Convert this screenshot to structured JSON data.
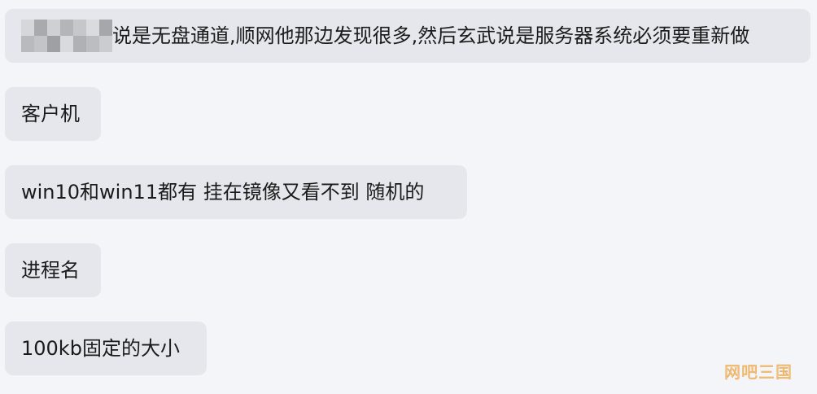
{
  "messages": [
    {
      "text": "说是无盘通道,顺网他那边发现很多,然后玄武说是服务器系统必须要重新做"
    },
    {
      "text": "客户机"
    },
    {
      "text": "win10和win11都有 挂在镜像又看不到 随机的"
    },
    {
      "text": "进程名"
    },
    {
      "text": "100kb固定的大小"
    }
  ],
  "watermark": "网吧三国",
  "colors": {
    "background": "#f4f5f9",
    "bubble": "#e5e7ec",
    "text": "#1b1b1b",
    "watermark": "#f4c27a"
  }
}
